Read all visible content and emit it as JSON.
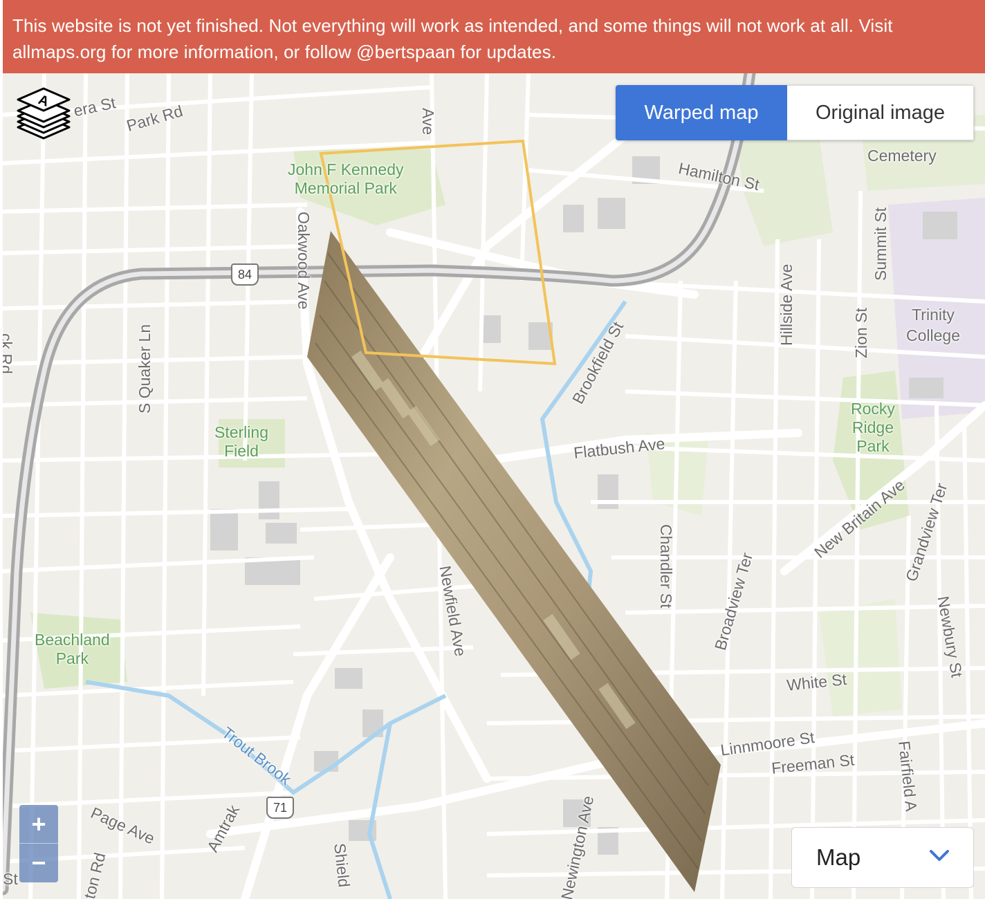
{
  "banner": {
    "text": "This website is not yet finished. Not everything will work as intended, and some things will not work at all. Visit allmaps.org for more information, or follow @bertspaan for updates."
  },
  "view_toggle": {
    "active_label": "Warped map",
    "inactive_label": "Original image"
  },
  "zoom": {
    "in_label": "+",
    "out_label": "−"
  },
  "basemap_select": {
    "value": "Map"
  },
  "colors": {
    "banner": "#d6604d",
    "active_button": "#3e76d8",
    "footprint_outline": "#f2c35a",
    "warped_map": "#a89677"
  },
  "map_labels": {
    "street_era": "era St",
    "park_rd": "Park Rd",
    "ave_top": "Ave",
    "jfk_park_1": "John F Kennedy",
    "jfk_park_2": "Memorial Park",
    "hamilton": "Hamilton St",
    "cemetery": "Cemetery",
    "oakwood": "Oakwood Ave",
    "route84": "84",
    "summit": "Summit St",
    "hillside": "Hillside Ave",
    "zion": "Zion St",
    "trinity_1": "Trinity",
    "trinity_2": "College",
    "brookfield": "Brookfield St",
    "quaker": "S Quaker Ln",
    "rocky_1": "Rocky",
    "rocky_2": "Ridge",
    "rocky_3": "Park",
    "sterling_1": "Sterling",
    "sterling_2": "Field",
    "flatbush": "Flatbush Ave",
    "new_britain": "New Britain Ave",
    "grandview": "Grandview Ter",
    "chandler": "Chandler St",
    "broadview": "Broadview Ter",
    "newfield": "Newfield Ave",
    "newbury": "Newbury St",
    "beachland_1": "Beachland",
    "beachland_2": "Park",
    "white": "White St",
    "linnmoore": "Linnmoore St",
    "freeman": "Freeman St",
    "fairfield": "Fairfield A",
    "trout_brook": "Trout Brook",
    "route71": "71",
    "page_ave": "Page Ave",
    "amtrak": "Amtrak",
    "newington": "Newington Ave",
    "shield_st": "Shield",
    "ton_rd": "ton Rd",
    "st_left": "St",
    "rd_left": "ck Rd"
  }
}
